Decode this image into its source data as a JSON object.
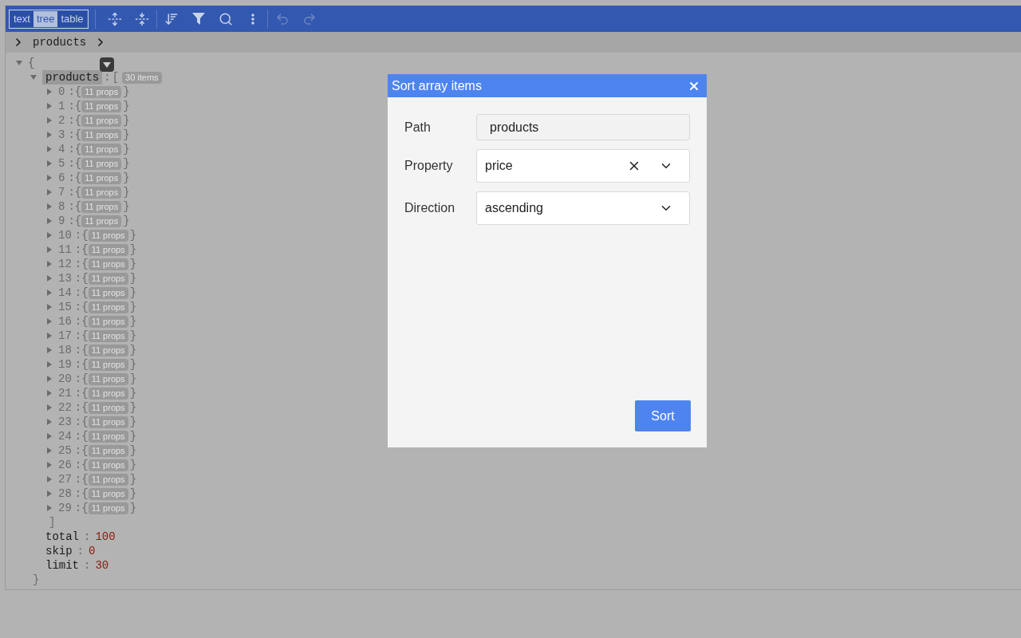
{
  "toolbar": {
    "modes": [
      {
        "label": "text",
        "selected": false
      },
      {
        "label": "tree",
        "selected": true
      },
      {
        "label": "table",
        "selected": false
      }
    ],
    "undo": {
      "disabled": true
    },
    "redo": {
      "disabled": true
    }
  },
  "breadcrumb": [
    "products"
  ],
  "tree": {
    "root_open": "{",
    "root_expanded": true,
    "root_close": "}",
    "array": {
      "key": "products",
      "separator": ":",
      "open": "[",
      "count": "30 items",
      "close": "]",
      "expanded": true,
      "items": [
        {
          "index": "0",
          "separator": ":",
          "open": "{",
          "badge": "11 props",
          "close": "}",
          "expanded": false
        },
        {
          "index": "1",
          "separator": ":",
          "open": "{",
          "badge": "11 props",
          "close": "}",
          "expanded": false
        },
        {
          "index": "2",
          "separator": ":",
          "open": "{",
          "badge": "11 props",
          "close": "}",
          "expanded": false
        },
        {
          "index": "3",
          "separator": ":",
          "open": "{",
          "badge": "11 props",
          "close": "}",
          "expanded": false
        },
        {
          "index": "4",
          "separator": ":",
          "open": "{",
          "badge": "11 props",
          "close": "}",
          "expanded": false
        },
        {
          "index": "5",
          "separator": ":",
          "open": "{",
          "badge": "11 props",
          "close": "}",
          "expanded": false
        },
        {
          "index": "6",
          "separator": ":",
          "open": "{",
          "badge": "11 props",
          "close": "}",
          "expanded": false
        },
        {
          "index": "7",
          "separator": ":",
          "open": "{",
          "badge": "11 props",
          "close": "}",
          "expanded": false
        },
        {
          "index": "8",
          "separator": ":",
          "open": "{",
          "badge": "11 props",
          "close": "}",
          "expanded": false
        },
        {
          "index": "9",
          "separator": ":",
          "open": "{",
          "badge": "11 props",
          "close": "}",
          "expanded": false
        },
        {
          "index": "10",
          "separator": ":",
          "open": "{",
          "badge": "11 props",
          "close": "}",
          "expanded": false
        },
        {
          "index": "11",
          "separator": ":",
          "open": "{",
          "badge": "11 props",
          "close": "}",
          "expanded": false
        },
        {
          "index": "12",
          "separator": ":",
          "open": "{",
          "badge": "11 props",
          "close": "}",
          "expanded": false
        },
        {
          "index": "13",
          "separator": ":",
          "open": "{",
          "badge": "11 props",
          "close": "}",
          "expanded": false
        },
        {
          "index": "14",
          "separator": ":",
          "open": "{",
          "badge": "11 props",
          "close": "}",
          "expanded": false
        },
        {
          "index": "15",
          "separator": ":",
          "open": "{",
          "badge": "11 props",
          "close": "}",
          "expanded": false
        },
        {
          "index": "16",
          "separator": ":",
          "open": "{",
          "badge": "11 props",
          "close": "}",
          "expanded": false
        },
        {
          "index": "17",
          "separator": ":",
          "open": "{",
          "badge": "11 props",
          "close": "}",
          "expanded": false
        },
        {
          "index": "18",
          "separator": ":",
          "open": "{",
          "badge": "11 props",
          "close": "}",
          "expanded": false
        },
        {
          "index": "19",
          "separator": ":",
          "open": "{",
          "badge": "11 props",
          "close": "}",
          "expanded": false
        },
        {
          "index": "20",
          "separator": ":",
          "open": "{",
          "badge": "11 props",
          "close": "}",
          "expanded": false
        },
        {
          "index": "21",
          "separator": ":",
          "open": "{",
          "badge": "11 props",
          "close": "}",
          "expanded": false
        },
        {
          "index": "22",
          "separator": ":",
          "open": "{",
          "badge": "11 props",
          "close": "}",
          "expanded": false
        },
        {
          "index": "23",
          "separator": ":",
          "open": "{",
          "badge": "11 props",
          "close": "}",
          "expanded": false
        },
        {
          "index": "24",
          "separator": ":",
          "open": "{",
          "badge": "11 props",
          "close": "}",
          "expanded": false
        },
        {
          "index": "25",
          "separator": ":",
          "open": "{",
          "badge": "11 props",
          "close": "}",
          "expanded": false
        },
        {
          "index": "26",
          "separator": ":",
          "open": "{",
          "badge": "11 props",
          "close": "}",
          "expanded": false
        },
        {
          "index": "27",
          "separator": ":",
          "open": "{",
          "badge": "11 props",
          "close": "}",
          "expanded": false
        },
        {
          "index": "28",
          "separator": ":",
          "open": "{",
          "badge": "11 props",
          "close": "}",
          "expanded": false
        },
        {
          "index": "29",
          "separator": ":",
          "open": "{",
          "badge": "11 props",
          "close": "}",
          "expanded": false
        }
      ]
    },
    "props": [
      {
        "key": "total",
        "separator": ":",
        "value": "100"
      },
      {
        "key": "skip",
        "separator": ":",
        "value": "0"
      },
      {
        "key": "limit",
        "separator": ":",
        "value": "30"
      }
    ]
  },
  "dialog": {
    "title": "Sort array items",
    "fields": [
      {
        "label": "Path",
        "kind": "readonly",
        "value": "products"
      },
      {
        "label": "Property",
        "kind": "select",
        "value": "price",
        "clearable": true
      },
      {
        "label": "Direction",
        "kind": "select",
        "value": "ascending",
        "clearable": false
      }
    ],
    "button": "Sort"
  }
}
